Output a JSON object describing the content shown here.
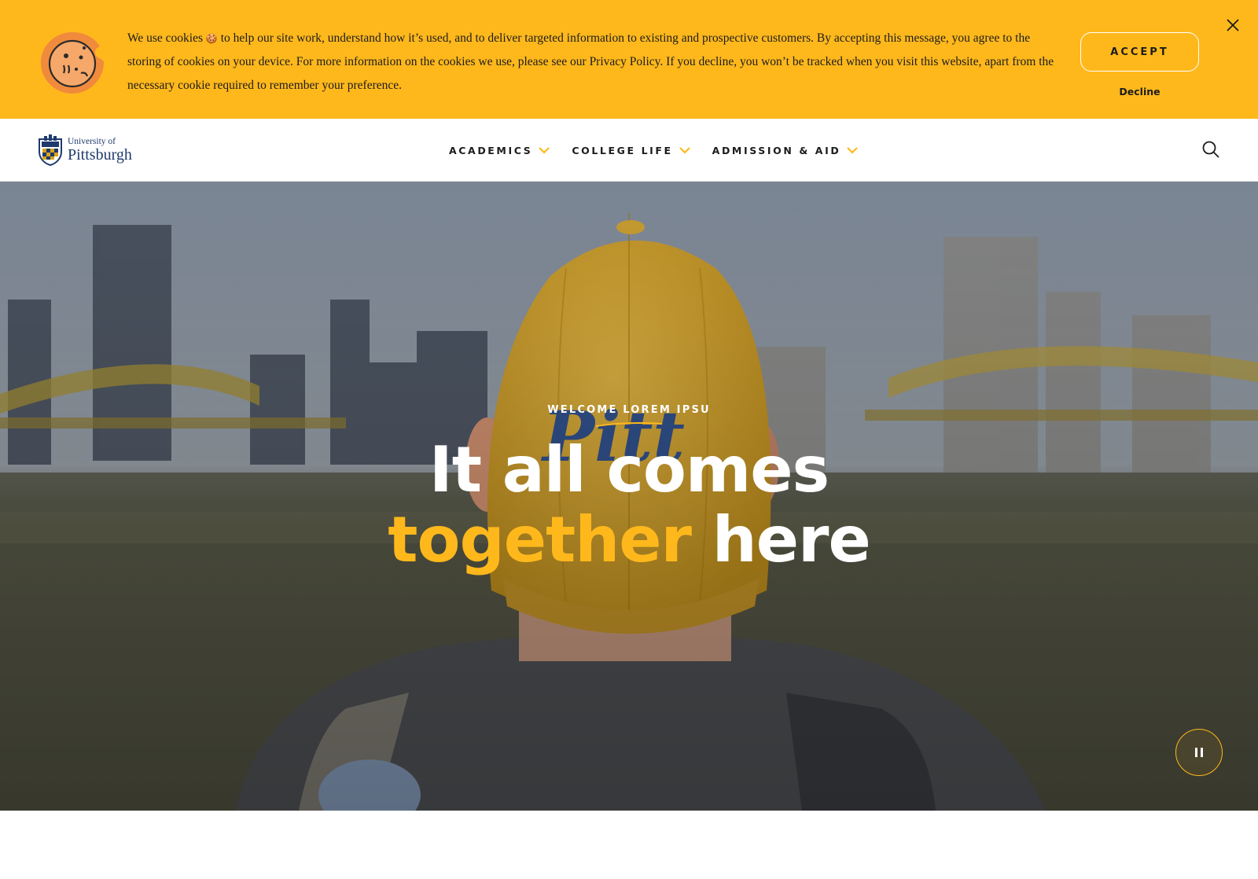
{
  "cookie_banner": {
    "text_part1": "We use cookies",
    "cookie_emoji": "🍪",
    "text_part2": " to help our site work, understand how it’s used, and to deliver targeted information to existing and prospective customers. By accepting this message, you agree to the storing of cookies on your device. For more information on the cookies we use, please see our ",
    "privacy_link": "Privacy Policy",
    "text_part3": ". If you decline, you won’t be tracked when you visit this website, apart from the necessary cookie required to remember your preference.",
    "accept_label": "ACCEPT",
    "decline_label": "Decline",
    "icon": "cookie-icon",
    "close_icon": "close-icon"
  },
  "nav": {
    "logo_small": "University of",
    "logo_big": "Pittsburgh",
    "items": [
      {
        "label": "ACADEMICS",
        "icon": "chevron-down-icon"
      },
      {
        "label": "COLLEGE LIFE",
        "icon": "chevron-down-icon"
      },
      {
        "label": "ADMISSION & AID",
        "icon": "chevron-down-icon"
      }
    ],
    "search_icon": "search-icon"
  },
  "hero": {
    "eyebrow": "WELCOME LOREM IPSU",
    "headline_line1": "It all comes",
    "headline_accent": "together",
    "headline_rest": " here",
    "pause_icon": "pause-icon"
  },
  "colors": {
    "gold": "#ffb81c",
    "navy": "#1f3a6d",
    "text": "#1c1c1c",
    "cookie_orange": "#f08a3c"
  }
}
